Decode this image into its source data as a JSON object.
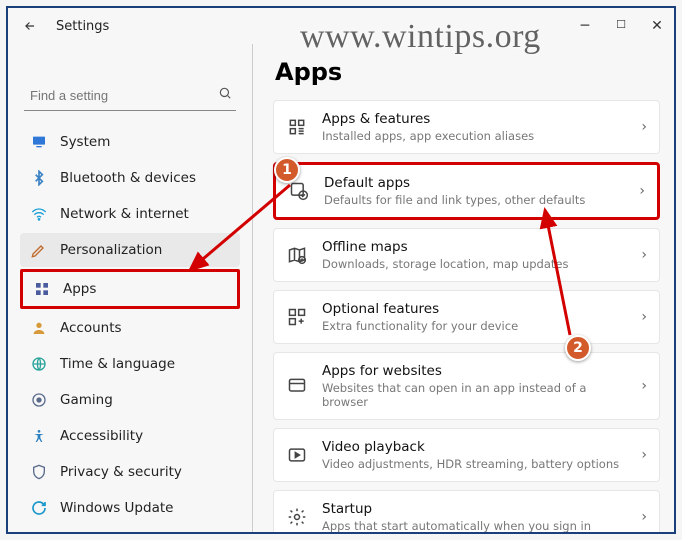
{
  "watermark": "www.wintips.org",
  "titlebar": {
    "title": "Settings"
  },
  "search": {
    "placeholder": "Find a setting"
  },
  "sidebar": {
    "items": [
      {
        "label": "System",
        "icon": "system-icon",
        "color": "#3078d7"
      },
      {
        "label": "Bluetooth & devices",
        "icon": "bluetooth-icon",
        "color": "#3b82c4"
      },
      {
        "label": "Network & internet",
        "icon": "network-icon",
        "color": "#1aa0d8"
      },
      {
        "label": "Personalization",
        "icon": "personalization-icon",
        "color": "#c06a2b"
      },
      {
        "label": "Apps",
        "icon": "apps-icon",
        "color": "#4a5b9e"
      },
      {
        "label": "Accounts",
        "icon": "accounts-icon",
        "color": "#d79a3b"
      },
      {
        "label": "Time & language",
        "icon": "time-language-icon",
        "color": "#2aa39a"
      },
      {
        "label": "Gaming",
        "icon": "gaming-icon",
        "color": "#5a6b8c"
      },
      {
        "label": "Accessibility",
        "icon": "accessibility-icon",
        "color": "#2b7fbf"
      },
      {
        "label": "Privacy & security",
        "icon": "privacy-icon",
        "color": "#5a6b8c"
      },
      {
        "label": "Windows Update",
        "icon": "update-icon",
        "color": "#1a98c9"
      }
    ]
  },
  "page": {
    "title": "Apps"
  },
  "cards": [
    {
      "title": "Apps & features",
      "desc": "Installed apps, app execution aliases"
    },
    {
      "title": "Default apps",
      "desc": "Defaults for file and link types, other defaults"
    },
    {
      "title": "Offline maps",
      "desc": "Downloads, storage location, map updates"
    },
    {
      "title": "Optional features",
      "desc": "Extra functionality for your device"
    },
    {
      "title": "Apps for websites",
      "desc": "Websites that can open in an app instead of a browser"
    },
    {
      "title": "Video playback",
      "desc": "Video adjustments, HDR streaming, battery options"
    },
    {
      "title": "Startup",
      "desc": "Apps that start automatically when you sign in"
    }
  ],
  "badges": {
    "one": "1",
    "two": "2"
  }
}
